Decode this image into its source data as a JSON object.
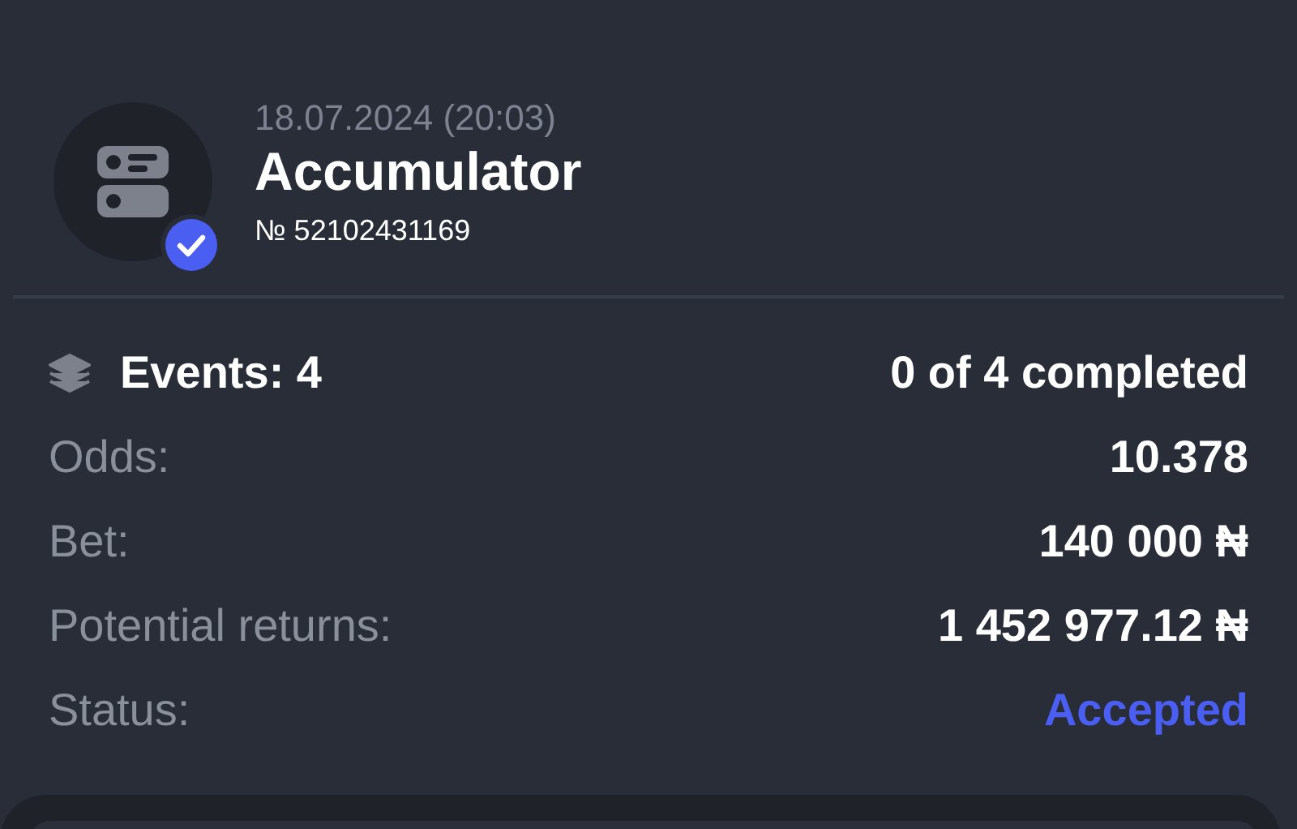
{
  "bet": {
    "date": "18.07.2024 (20:03)",
    "title": "Accumulator",
    "number": "№ 52102431169",
    "verified": true
  },
  "events": {
    "label": "Events: 4",
    "progress": "0 of 4 completed"
  },
  "rows": [
    {
      "kind": "plain",
      "label": "Odds:",
      "value": "10.378"
    },
    {
      "kind": "plain",
      "label": "Bet:",
      "value": "140 000 ₦"
    },
    {
      "kind": "plain",
      "label": "Potential returns:",
      "value": "1 452 977.12 ₦"
    },
    {
      "kind": "status",
      "label": "Status:",
      "value": "Accepted"
    }
  ]
}
